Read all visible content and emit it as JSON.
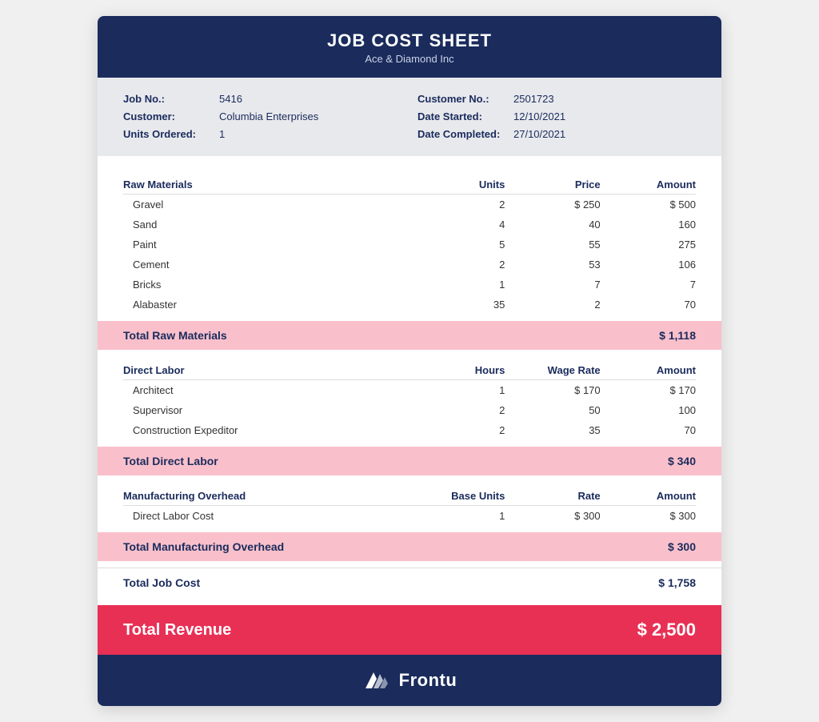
{
  "header": {
    "title": "JOB COST SHEET",
    "subtitle": "Ace & Diamond Inc"
  },
  "info": {
    "job_no_label": "Job No.:",
    "job_no_value": "5416",
    "customer_label": "Customer:",
    "customer_value": "Columbia Enterprises",
    "units_label": "Units Ordered:",
    "units_value": "1",
    "customer_no_label": "Customer No.:",
    "customer_no_value": "2501723",
    "date_started_label": "Date Started:",
    "date_started_value": "12/10/2021",
    "date_completed_label": "Date Completed:",
    "date_completed_value": "27/10/2021"
  },
  "raw_materials": {
    "section_title": "Raw Materials",
    "col_units": "Units",
    "col_price": "Price",
    "col_amount": "Amount",
    "items": [
      {
        "name": "Gravel",
        "units": "2",
        "price": "$ 250",
        "amount": "$ 500"
      },
      {
        "name": "Sand",
        "units": "4",
        "price": "40",
        "amount": "160"
      },
      {
        "name": "Paint",
        "units": "5",
        "price": "55",
        "amount": "275"
      },
      {
        "name": "Cement",
        "units": "2",
        "price": "53",
        "amount": "106"
      },
      {
        "name": "Bricks",
        "units": "1",
        "price": "7",
        "amount": "7"
      },
      {
        "name": "Alabaster",
        "units": "35",
        "price": "2",
        "amount": "70"
      }
    ],
    "total_label": "Total Raw Materials",
    "total_value": "$ 1,118"
  },
  "direct_labor": {
    "section_title": "Direct Labor",
    "col_hours": "Hours",
    "col_wage_rate": "Wage Rate",
    "col_amount": "Amount",
    "items": [
      {
        "name": "Architect",
        "hours": "1",
        "wage_rate": "$ 170",
        "amount": "$ 170"
      },
      {
        "name": "Supervisor",
        "hours": "2",
        "wage_rate": "50",
        "amount": "100"
      },
      {
        "name": "Construction Expeditor",
        "hours": "2",
        "wage_rate": "35",
        "amount": "70"
      }
    ],
    "total_label": "Total Direct Labor",
    "total_value": "$ 340"
  },
  "mfg_overhead": {
    "section_title": "Manufacturing Overhead",
    "col_base_units": "Base Units",
    "col_rate": "Rate",
    "col_amount": "Amount",
    "items": [
      {
        "name": "Direct Labor Cost",
        "base_units": "1",
        "rate": "$ 300",
        "amount": "$ 300"
      }
    ],
    "total_label": "Total Manufacturing Overhead",
    "total_value": "$ 300"
  },
  "total_job_cost": {
    "label": "Total Job Cost",
    "value": "$ 1,758"
  },
  "total_revenue": {
    "label": "Total Revenue",
    "value": "$ 2,500"
  },
  "footer": {
    "brand": "Frontu"
  }
}
